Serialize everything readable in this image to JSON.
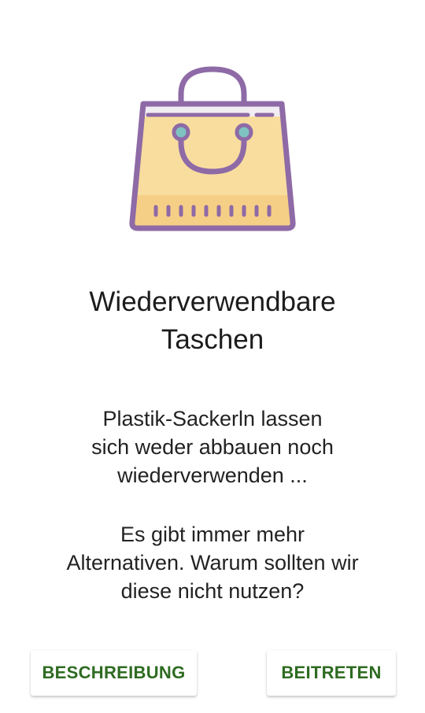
{
  "illustration": {
    "icon": "shopping-bag-icon",
    "colors": {
      "outline": "#8e6aa6",
      "bag_fill": "#f8dd9f",
      "bag_bottom": "#f6cf86",
      "top_band": "#f1edf3",
      "eyelets": "#7ec3c0"
    }
  },
  "title": {
    "line1": "Wiederverwendbare",
    "line2": "Taschen"
  },
  "description": {
    "paragraph1": {
      "line1": "Plastik-Sackerln lassen",
      "line2": "sich weder abbauen noch",
      "line3": "wiederverwenden ..."
    },
    "paragraph2": {
      "line1": "Es gibt immer mehr",
      "line2": "Alternativen.  Warum sollten wir",
      "line3": "diese nicht nutzen?"
    }
  },
  "actions": {
    "description_label": "BESCHREIBUNG",
    "join_label": "BEITRETEN",
    "accent_color": "#2e6b21"
  }
}
